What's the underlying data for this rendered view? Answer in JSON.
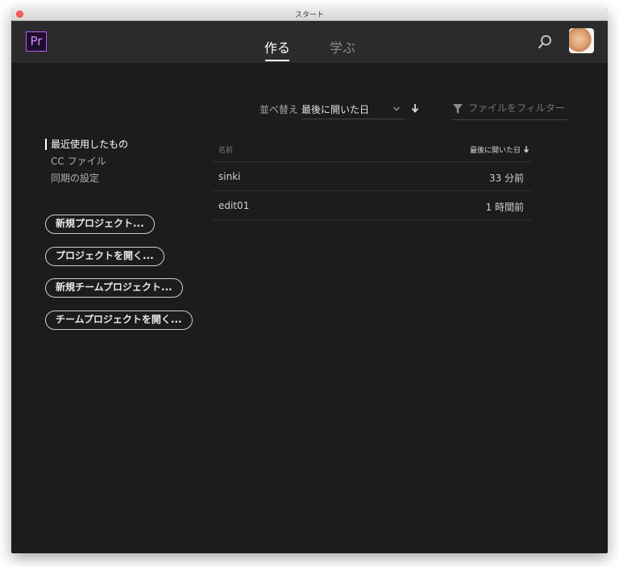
{
  "window": {
    "title": "スタート"
  },
  "app": {
    "logo_text": "Pr"
  },
  "tabs": [
    {
      "label": "作る",
      "active": true
    },
    {
      "label": "学ぶ",
      "active": false
    }
  ],
  "sort": {
    "label": "並べ替え",
    "value": "最後に開いた日"
  },
  "filter": {
    "placeholder": "ファイルをフィルター"
  },
  "sidebar": {
    "items": [
      {
        "label": "最近使用したもの",
        "active": true
      },
      {
        "label": "CC ファイル",
        "active": false
      },
      {
        "label": "同期の設定",
        "active": false
      }
    ]
  },
  "actions": {
    "new_project": "新規プロジェクト...",
    "open_project": "プロジェクトを開く...",
    "new_team_project": "新規チームプロジェクト...",
    "open_team_project": "チームプロジェクトを開く..."
  },
  "table": {
    "columns": {
      "name": "名前",
      "date": "最後に開いた日"
    },
    "rows": [
      {
        "name": "sinki",
        "date": "33 分前"
      },
      {
        "name": "edit01",
        "date": "1 時間前"
      }
    ]
  },
  "icons": [
    "close-dot",
    "search-icon",
    "chevron-down-icon",
    "arrow-down-icon",
    "filter-icon",
    "avatar"
  ],
  "colors": {
    "accent_purple": "#b75cff",
    "background": "#1c1c1c",
    "appbar": "#2b2b2b"
  }
}
